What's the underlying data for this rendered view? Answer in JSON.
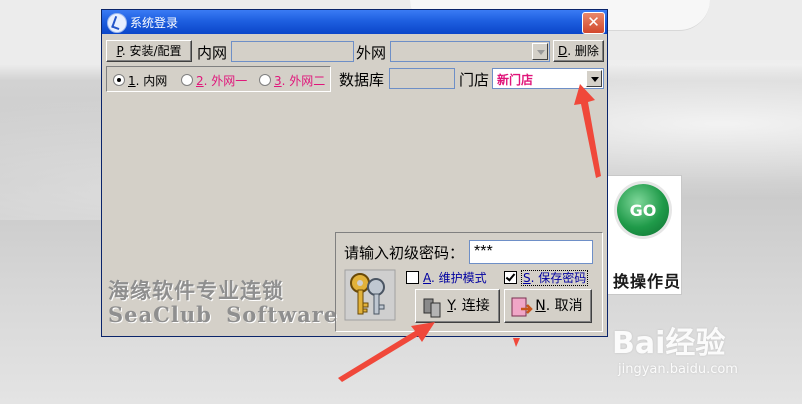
{
  "dialog": {
    "title": "系统登录",
    "close_label": "✕",
    "install_button": {
      "key": "P",
      "label": ". 安装/配置"
    },
    "intranet_label": "内网",
    "intranet_value": "",
    "extranet_label": "外网",
    "extranet_value": "",
    "delete_button": {
      "key": "D",
      "label": ". 删除"
    },
    "network_options": [
      {
        "key": "1",
        "label": ". 内网",
        "selected": true
      },
      {
        "key": "2",
        "label": ". 外网一",
        "selected": false
      },
      {
        "key": "3",
        "label": ". 外网二",
        "selected": false
      }
    ],
    "database_label": "数据库",
    "database_value": "",
    "store_label": "门店",
    "store_value": "新门店",
    "brand_cn": "海缘软件专业连锁",
    "brand_en": "SeaClub Software",
    "login": {
      "password_prompt": "请输入初级密码：",
      "password_value": "***",
      "maintenance": {
        "key": "A",
        "label": ". 维护模式",
        "checked": false
      },
      "save_password": {
        "key": "S",
        "label": ". 保存密码",
        "checked": true
      },
      "connect_button": {
        "key": "Y",
        "label": ". 连接"
      },
      "cancel_button": {
        "key": "N",
        "label": ". 取消"
      }
    }
  },
  "background": {
    "go_tile": {
      "circle_text": "GO",
      "caption": "换操作员"
    },
    "watermark": {
      "logo": "Bai经验",
      "url": "jingyan.baidu.com"
    }
  },
  "colors": {
    "titlebar": "#1e5fe0",
    "dialog_bg": "#d4d0c8",
    "accent_pink": "#e0157a",
    "arrow_red": "#f0483a"
  }
}
